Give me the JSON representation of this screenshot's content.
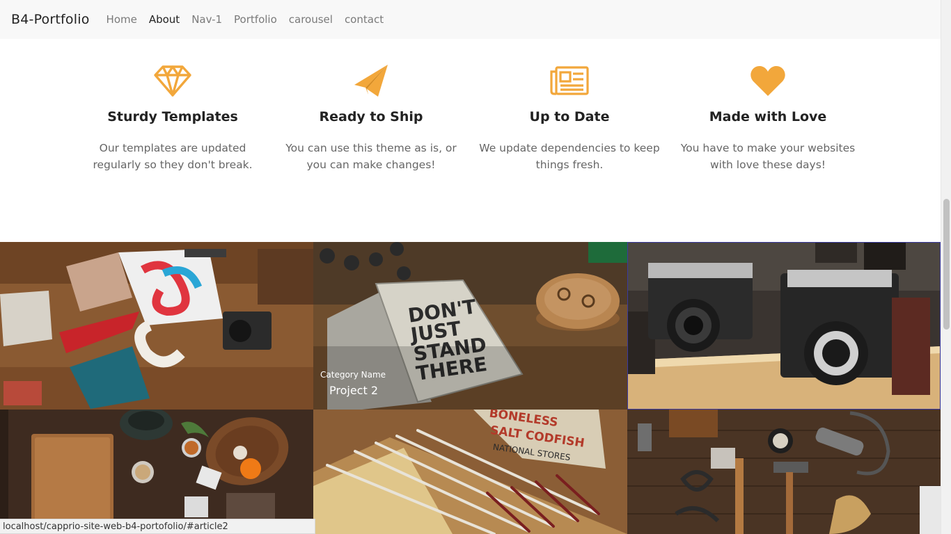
{
  "navbar": {
    "brand": "B4-Portfolio",
    "links": [
      "Home",
      "About",
      "Nav-1",
      "Portfolio",
      "carousel",
      "contact"
    ],
    "active": "About"
  },
  "accent_color": "#f2a73b",
  "services": [
    {
      "icon": "diamond-icon",
      "title": "Sturdy Templates",
      "text": "Our templates are updated regularly so they don't break."
    },
    {
      "icon": "paper-plane-icon",
      "title": "Ready to Ship",
      "text": "You can use this theme as is, or you can make changes!"
    },
    {
      "icon": "newspaper-icon",
      "title": "Up to Date",
      "text": "We update dependencies to keep things fresh."
    },
    {
      "icon": "heart-icon",
      "title": "Made with Love",
      "text": "You have to make your websites with love these days!"
    }
  ],
  "portfolio": {
    "hover_caption": {
      "category": "Category Name",
      "title": "Project 2"
    }
  },
  "status_bar": "localhost/capprio-site-web-b4-portofolio/#article2"
}
